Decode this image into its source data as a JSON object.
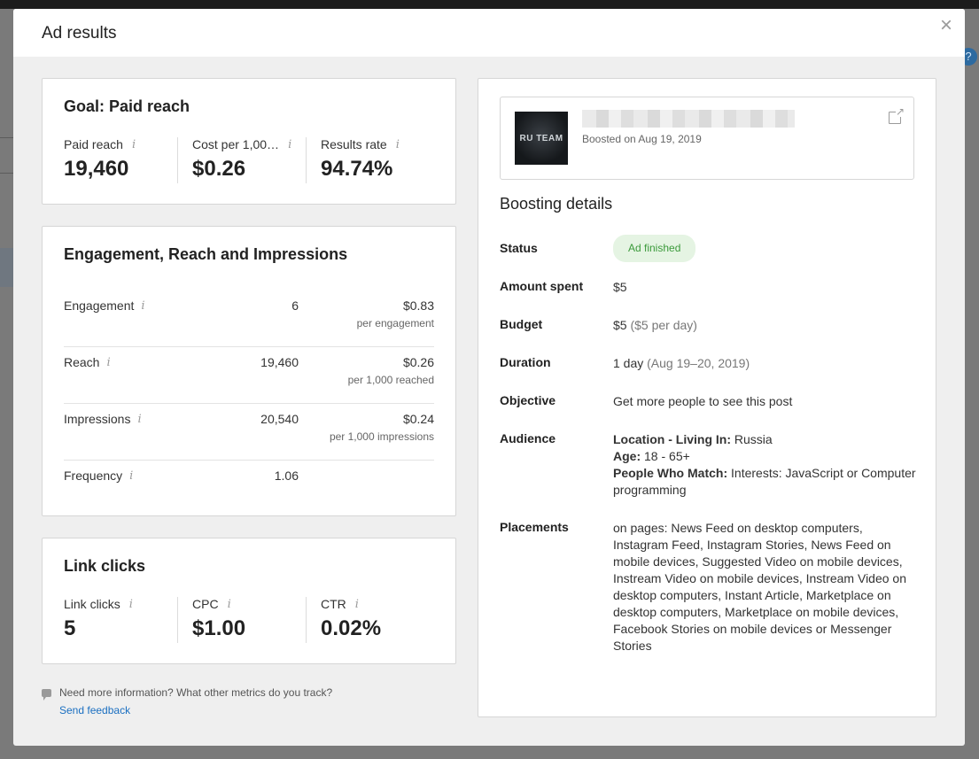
{
  "modal": {
    "title": "Ad results",
    "close_label": "×"
  },
  "goal": {
    "title": "Goal: Paid reach",
    "metrics": [
      {
        "label": "Paid reach",
        "value": "19,460"
      },
      {
        "label": "Cost per 1,00…",
        "value": "$0.26"
      },
      {
        "label": "Results rate",
        "value": "94.74%"
      }
    ]
  },
  "engagement": {
    "title": "Engagement, Reach and Impressions",
    "rows": [
      {
        "label": "Engagement",
        "count": "6",
        "cost": "$0.83",
        "sub": "per engagement"
      },
      {
        "label": "Reach",
        "count": "19,460",
        "cost": "$0.26",
        "sub": "per 1,000 reached"
      },
      {
        "label": "Impressions",
        "count": "20,540",
        "cost": "$0.24",
        "sub": "per 1,000 impressions"
      },
      {
        "label": "Frequency",
        "count": "1.06",
        "cost": "",
        "sub": ""
      }
    ]
  },
  "link_clicks": {
    "title": "Link clicks",
    "metrics": [
      {
        "label": "Link clicks",
        "value": "5"
      },
      {
        "label": "CPC",
        "value": "$1.00"
      },
      {
        "label": "CTR",
        "value": "0.02%"
      }
    ]
  },
  "feedback": {
    "question": "Need more information? What other metrics do you track?",
    "link": "Send feedback"
  },
  "post": {
    "thumb_text": "RU TEAM",
    "date": "Boosted on Aug 19, 2019"
  },
  "boosting": {
    "title": "Boosting details",
    "status_label": "Status",
    "status_value": "Ad finished",
    "amount_label": "Amount spent",
    "amount_value": "$5",
    "budget_label": "Budget",
    "budget_value": "$5",
    "budget_note": "($5 per day)",
    "duration_label": "Duration",
    "duration_value": "1 day",
    "duration_note": "(Aug 19–20, 2019)",
    "objective_label": "Objective",
    "objective_value": "Get more people to see this post",
    "audience_label": "Audience",
    "audience_location_key": "Location - Living In:",
    "audience_location_val": "Russia",
    "audience_age_key": "Age:",
    "audience_age_val": "18 - 65+",
    "audience_match_key": "People Who Match:",
    "audience_match_val": "Interests: JavaScript or Computer programming",
    "placements_label": "Placements",
    "placements_value": "on pages: News Feed on desktop computers, Instagram Feed, Instagram Stories, News Feed on mobile devices, Suggested Video on mobile devices, Instream Video on mobile devices, Instream Video on desktop computers, Instant Article, Marketplace on desktop computers, Marketplace on mobile devices, Facebook Stories on mobile devices or Messenger Stories"
  },
  "colors": {
    "accent_link": "#1a6fc1",
    "status_green": "#3b9a3b",
    "status_bg": "#e5f4e3"
  }
}
